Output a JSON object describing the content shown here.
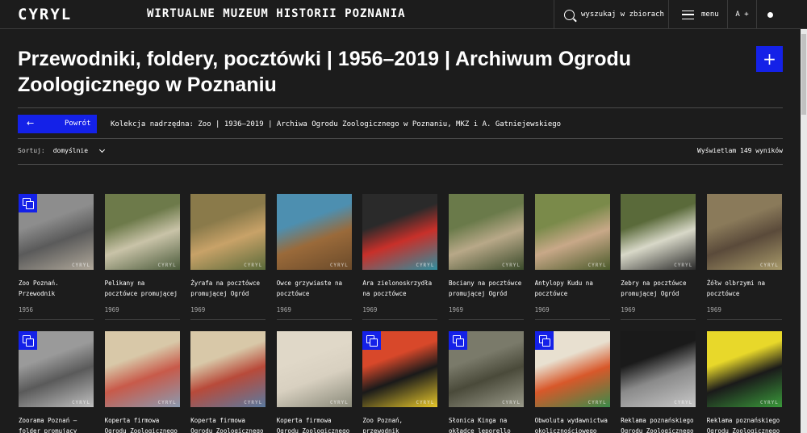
{
  "header": {
    "logo": "CYRYL",
    "site_title": "WIRTUALNE MUZEUM HISTORII POZNANIA",
    "search_label": "wyszukaj w zbiorach",
    "menu_label": "menu",
    "font_label": "A +"
  },
  "page": {
    "title": "Przewodniki, foldery, pocztówki | 1956–2019 | Archiwum Ogrodu Zoologicznego w Poznaniu",
    "add_label": "+",
    "back_label": "Powrót",
    "back_arrow": "←",
    "parent_collection": "Kolekcja nadrzędna: Zoo | 1936–2019 | Archiwa Ogrodu Zoologicznego w Poznaniu, MKZ i A. Gatniejewskiego"
  },
  "toolbar": {
    "sort_label": "Sortuj:",
    "sort_value": "domyślnie",
    "results_text": "Wyświetlam 149 wyników"
  },
  "watermark": "CYRYL",
  "items": [
    {
      "title": "Zoo Poznań. Przewodnik",
      "year": "1956",
      "multi": true,
      "colors": [
        "#8d8d8d",
        "#5a5a5a",
        "#b0a89a"
      ]
    },
    {
      "title": "Pelikany na pocztówce promującej Ogród",
      "year": "1969",
      "multi": false,
      "colors": [
        "#6d7a4a",
        "#c9c3a8",
        "#4a5a3a"
      ]
    },
    {
      "title": "Żyrafa na pocztówce promującej Ogród",
      "year": "1969",
      "multi": false,
      "colors": [
        "#8a7a4a",
        "#c8a268",
        "#5a6a3a"
      ]
    },
    {
      "title": "Owce grzywiaste na pocztówce",
      "year": "1969",
      "multi": false,
      "colors": [
        "#4d8fb0",
        "#9a6a3a",
        "#6a4a2a"
      ]
    },
    {
      "title": "Ara zielonoskrzydła na pocztówce",
      "year": "1969",
      "multi": false,
      "colors": [
        "#2a2a2a",
        "#c8302a",
        "#2f8fa0"
      ]
    },
    {
      "title": "Bociany na pocztówce promującej Ogród",
      "year": "1969",
      "multi": false,
      "colors": [
        "#6a7a4a",
        "#b8a888",
        "#3a4a2a"
      ]
    },
    {
      "title": "Antylopy Kudu na pocztówce",
      "year": "1969",
      "multi": false,
      "colors": [
        "#7a8a4a",
        "#c8a888",
        "#4a5a2a"
      ]
    },
    {
      "title": "Zebry na pocztówce promującej Ogród",
      "year": "1969",
      "multi": false,
      "colors": [
        "#5a6a3a",
        "#d8d8c8",
        "#2a2a2a"
      ]
    },
    {
      "title": "Żółw olbrzymi na pocztówce",
      "year": "1969",
      "multi": false,
      "colors": [
        "#8a7a5a",
        "#5a4a3a",
        "#a89a6a"
      ]
    },
    {
      "title": "Zoorama Poznań – folder promujący",
      "year": "",
      "multi": true,
      "colors": [
        "#9a9a9a",
        "#5a5a5a",
        "#c0c0c0"
      ]
    },
    {
      "title": "Koperta firmowa Ogrodu Zoologicznego",
      "year": "",
      "multi": false,
      "colors": [
        "#d8c8a8",
        "#c85a4a",
        "#8a9ab0"
      ]
    },
    {
      "title": "Koperta firmowa Ogrodu Zoologicznego",
      "year": "",
      "multi": false,
      "colors": [
        "#d8c8a8",
        "#b84a3a",
        "#5a7aa0"
      ]
    },
    {
      "title": "Koperta firmowa Ogrodu Zoologicznego",
      "year": "",
      "multi": false,
      "colors": [
        "#e0d8c8",
        "#d8d0c0",
        "#8a8a7a"
      ]
    },
    {
      "title": "Zoo Poznań, przewodnik",
      "year": "",
      "multi": true,
      "colors": [
        "#d8482a",
        "#1a1a1a",
        "#e8c82a"
      ]
    },
    {
      "title": "Słonica Kinga na okładce leporello",
      "year": "",
      "multi": true,
      "colors": [
        "#7a7a6a",
        "#4a4a3a",
        "#9a9a8a"
      ]
    },
    {
      "title": "Obwoluta wydawnictwa okolicznościowego",
      "year": "",
      "multi": true,
      "colors": [
        "#e8e0d0",
        "#d8582a",
        "#3a8a4a"
      ]
    },
    {
      "title": "Reklama poznańskiego Ogrodu Zoologicznego",
      "year": "",
      "multi": false,
      "colors": [
        "#1a1a1a",
        "#8a8a8a",
        "#c8c8c8"
      ]
    },
    {
      "title": "Reklama poznańskiego Ogrodu Zoologicznego",
      "year": "",
      "multi": false,
      "colors": [
        "#e8d82a",
        "#1a1a1a",
        "#3a9a3a"
      ]
    }
  ]
}
